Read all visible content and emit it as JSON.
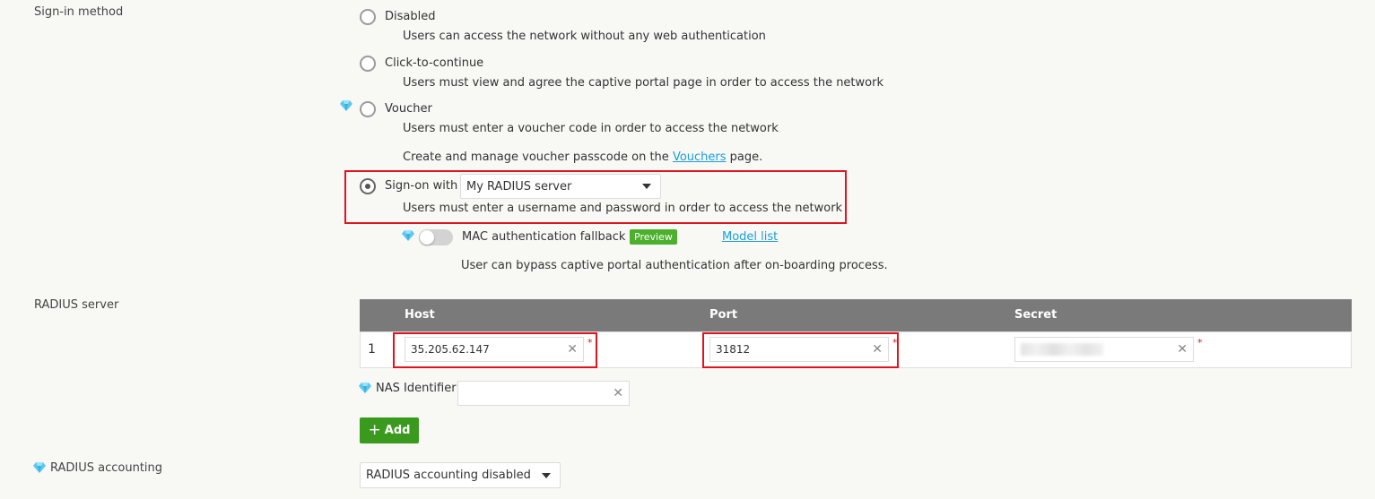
{
  "signin": {
    "label": "Sign-in method",
    "options": [
      {
        "title": "Disabled",
        "desc": "Users can access the network without any web authentication"
      },
      {
        "title": "Click-to-continue",
        "desc": "Users must view and agree the captive portal page in order to access the network"
      },
      {
        "title": "Voucher",
        "desc": "Users must enter a voucher code in order to access the network"
      },
      {
        "title": "Sign-on with",
        "desc": "Users must enter a username and password in order to access the network"
      }
    ],
    "voucher_note_prefix": "Create and manage voucher passcode on the",
    "voucher_link": "Vouchers",
    "voucher_note_suffix": "page.",
    "signon_select": "My RADIUS server",
    "mac_label": "MAC authentication fallback",
    "mac_badge": "Preview",
    "model_list": "Model list",
    "mac_desc": "User can bypass captive portal authentication after on-boarding process."
  },
  "radius": {
    "label": "RADIUS server",
    "columns": [
      "Host",
      "Port",
      "Secret"
    ],
    "rows": [
      {
        "index": "1",
        "host": "35.205.62.147",
        "port": "31812"
      }
    ],
    "nas_label": "NAS Identifier",
    "add_label": "Add"
  },
  "accounting": {
    "label": "RADIUS accounting",
    "select": "RADIUS accounting disabled"
  },
  "colors": {
    "accent_link": "#1aa0d8",
    "highlight": "#e0141e",
    "add_button": "#3a9a1e",
    "preview_badge": "#4caf2d",
    "table_header": "#7a7a7a"
  }
}
